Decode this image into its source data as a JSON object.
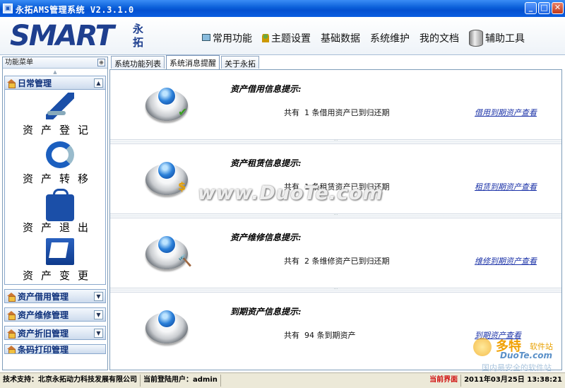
{
  "window": {
    "title": "永拓AMS管理系统 V2.3.1.0",
    "buttons": {
      "minimize": "_",
      "maximize": "□",
      "close": "✕"
    }
  },
  "header": {
    "logo_main": "SMART",
    "logo_sub": "永拓",
    "nav": [
      {
        "label": "常用功能",
        "icon": "monitor-icon"
      },
      {
        "label": "主题设置",
        "icon": "person-icon"
      },
      {
        "label": "基础数据"
      },
      {
        "label": "系统维护"
      },
      {
        "label": "我的文档"
      },
      {
        "label": "辅助工具",
        "icon": "database-icon"
      }
    ]
  },
  "sidebar": {
    "title": "功能菜单",
    "groups": [
      {
        "label": "日常管理",
        "expanded": true
      },
      {
        "label": "资产借用管理"
      },
      {
        "label": "资产维修管理"
      },
      {
        "label": "资产折旧管理"
      },
      {
        "label": "条码打印管理"
      }
    ],
    "functions": [
      {
        "label": "资产登记",
        "icon": "pen-icon"
      },
      {
        "label": "资产转移",
        "icon": "transfer-arrow-icon"
      },
      {
        "label": "资产退出",
        "icon": "bag-icon"
      },
      {
        "label": "资产变更",
        "icon": "folder-icon"
      }
    ]
  },
  "tabs": [
    {
      "label": "系统功能列表"
    },
    {
      "label": "系统消息提醒",
      "active": true
    },
    {
      "label": "关于永拓"
    }
  ],
  "cards": [
    {
      "title": "资产借用信息提示:",
      "message": "共有  1 条借用资产已到归还期",
      "link": "借用到期资产查看",
      "badge": "✔",
      "badge_color": "#3aa020"
    },
    {
      "title": "资产租赁信息提示:",
      "message": "共有  1 条租赁资产已到归还期",
      "link": "租赁到期资产查看",
      "badge": "$",
      "badge_color": "#e8a000"
    },
    {
      "title": "资产维修信息提示:",
      "message": "共有  2 条维修资产已到归还期",
      "link": "维修到期资产查看",
      "badge": "🔨",
      "badge_color": "#8a5a20"
    },
    {
      "title": "到期资产信息提示:",
      "message": "共有  94 条到期资产",
      "link": "到期资产查看",
      "badge": "",
      "badge_color": "#000000"
    }
  ],
  "watermark": {
    "main": "www.DuoTe.com",
    "corner_cn": "多特",
    "corner_small": "软件站",
    "corner_en": "DuoTe.com",
    "corner_bottom": "国内最安全的软件站"
  },
  "status": {
    "support": "技术支持：北京永拓动力科技发展有限公司",
    "user": "当前登陆用户：admin",
    "current": "当前界面",
    "datetime": "2011年03月25日 13:38:21"
  },
  "colors": {
    "titlebar": "#0a5fd8",
    "status_red": "#d01010",
    "link": "#1c33a8"
  }
}
